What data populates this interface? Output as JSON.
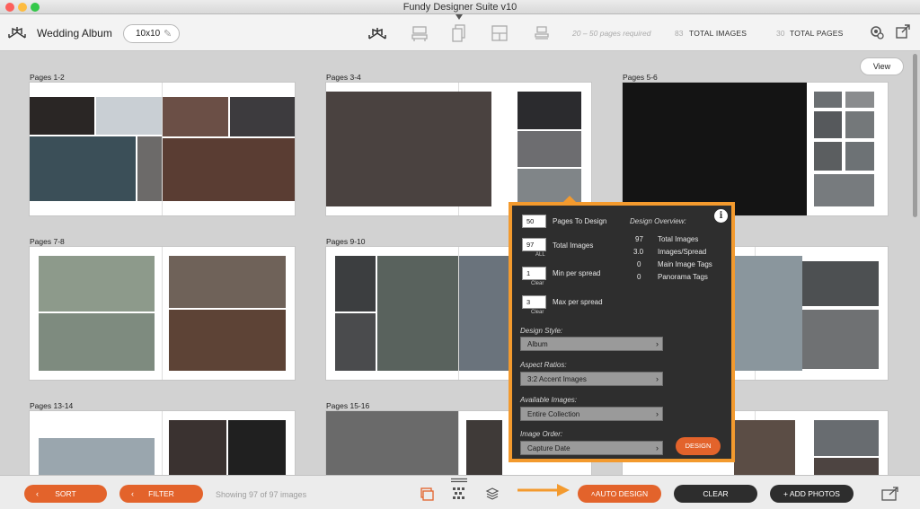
{
  "window": {
    "title": "Fundy Designer Suite v10"
  },
  "toolbar": {
    "album_title": "Wedding Album",
    "size": "10x10",
    "pages_required": "20 – 50 pages required",
    "total_images_count": "83",
    "total_images_label": "TOTAL IMAGES",
    "total_pages_count": "30",
    "total_pages_label": "TOTAL PAGES"
  },
  "view_button": "View",
  "spreads": [
    {
      "label": "Pages 1-2"
    },
    {
      "label": "Pages 3-4"
    },
    {
      "label": "Pages 5-6"
    },
    {
      "label": "Pages 7-8"
    },
    {
      "label": "Pages 9-10"
    },
    {
      "label": "Pages 13-14"
    },
    {
      "label": "Pages 15-16"
    }
  ],
  "panel": {
    "pages_to_design_value": "50",
    "pages_to_design_label": "Pages To Design",
    "total_images_value": "97",
    "total_images_label": "Total Images",
    "all_label": "ALL",
    "min_per_spread_value": "1",
    "min_per_spread_label": "Min per spread",
    "max_per_spread_value": "3",
    "max_per_spread_label": "Max per spread",
    "clear_label": "Clear",
    "overview_title": "Design Overview:",
    "overview": [
      {
        "value": "97",
        "label": "Total Images"
      },
      {
        "value": "3.0",
        "label": "Images/Spread"
      },
      {
        "value": "0",
        "label": "Main Image Tags"
      },
      {
        "value": "0",
        "label": "Panorama Tags"
      }
    ],
    "design_style_label": "Design Style:",
    "design_style_value": "Album",
    "aspect_ratios_label": "Aspect Ratios:",
    "aspect_ratios_value": "3:2 Accent Images",
    "available_images_label": "Available Images:",
    "available_images_value": "Entire Collection",
    "image_order_label": "Image Order:",
    "image_order_value": "Capture Date",
    "design_button": "DESIGN"
  },
  "bottombar": {
    "sort": "SORT",
    "filter": "FILTER",
    "showing": "Showing 97 of 97 images",
    "auto_design": "AUTO DESIGN",
    "clear": "CLEAR",
    "add_photos": "+ ADD PHOTOS"
  },
  "colors": {
    "accent_orange": "#e3632b",
    "panel_border": "#f39a2e",
    "panel_bg": "#2e2e2e"
  }
}
